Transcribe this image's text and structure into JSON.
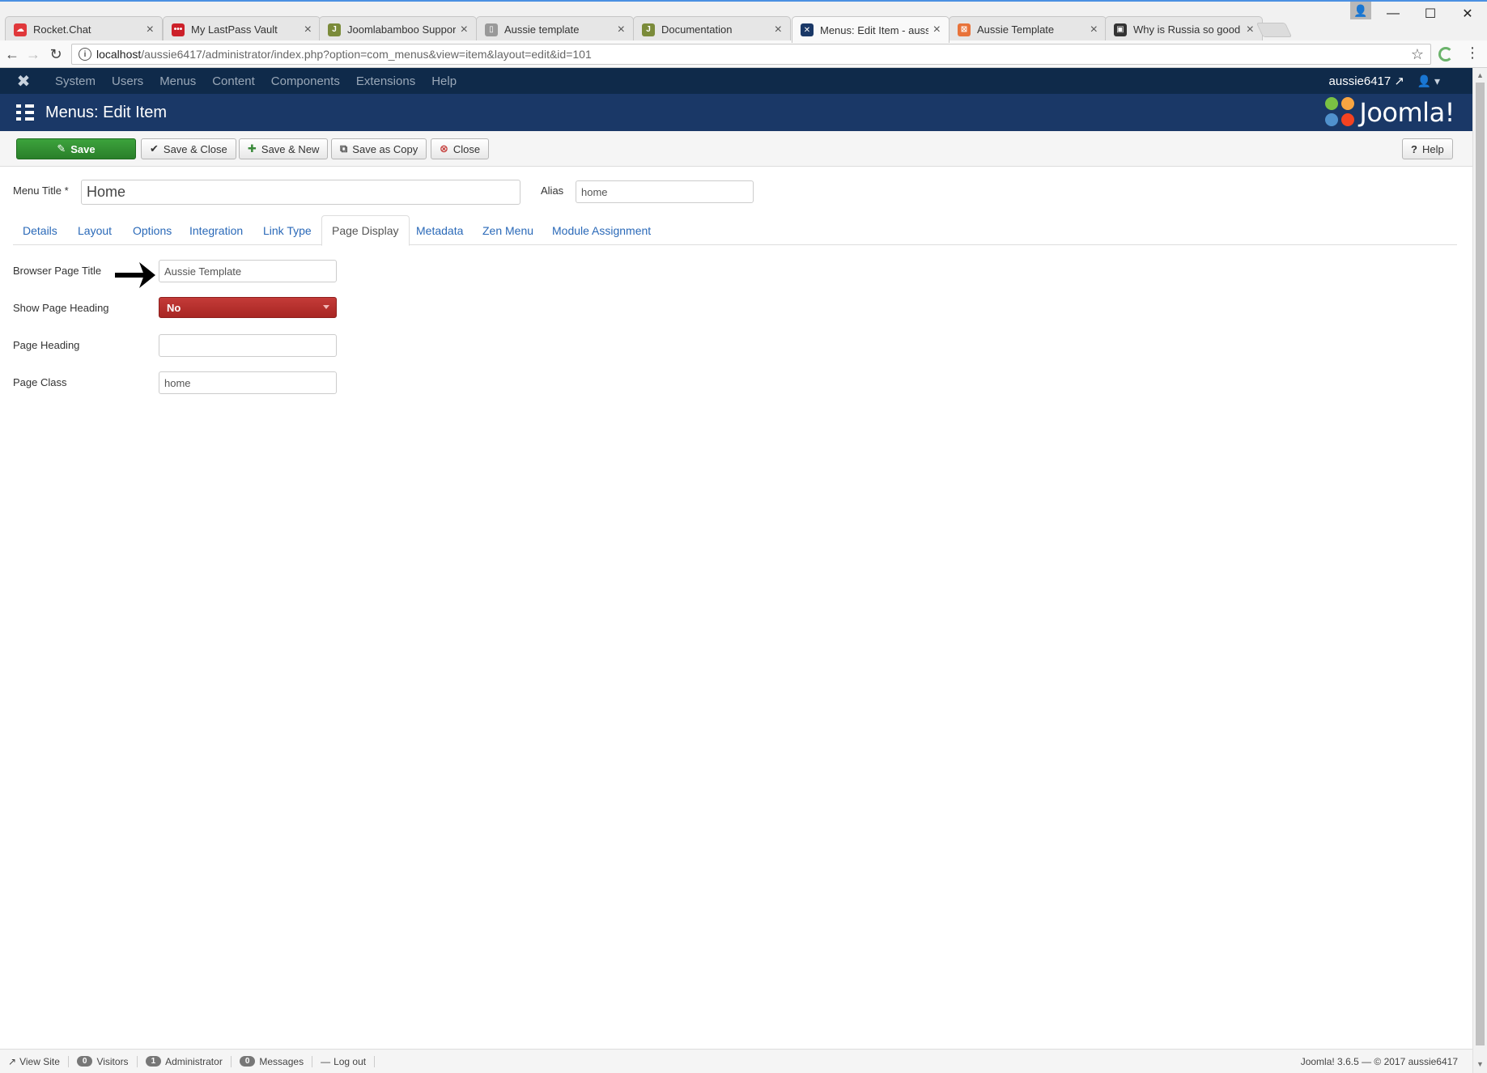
{
  "browser": {
    "tabs": [
      {
        "label": "Rocket.Chat",
        "fav_color": "#e0383b",
        "fav_glyph": "☁"
      },
      {
        "label": "My LastPass Vault",
        "fav_color": "#cc2029",
        "fav_glyph": "•••"
      },
      {
        "label": "Joomlabamboo Support",
        "fav_color": "#7b8b3a",
        "fav_glyph": "J"
      },
      {
        "label": "Aussie template",
        "fav_color": "#999999",
        "fav_glyph": "▯"
      },
      {
        "label": "Documentation",
        "fav_color": "#7b8b3a",
        "fav_glyph": "J"
      },
      {
        "label": "Menus: Edit Item - aussie",
        "fav_color": "#1a3867",
        "fav_glyph": "✕"
      },
      {
        "label": "Aussie Template",
        "fav_color": "#e8733a",
        "fav_glyph": "⊠"
      },
      {
        "label": "Why is Russia so good at",
        "fav_color": "#333333",
        "fav_glyph": "▣"
      }
    ],
    "url_host": "localhost",
    "url_path": "/aussie6417/administrator/index.php?option=com_menus&view=item&layout=edit&id=101"
  },
  "topnav": {
    "items": [
      "System",
      "Users",
      "Menus",
      "Content",
      "Components",
      "Extensions",
      "Help"
    ],
    "user": "aussie6417"
  },
  "header": {
    "title": "Menus: Edit Item",
    "brand": "Joomla!"
  },
  "toolbar": {
    "save": "Save",
    "save_close": "Save & Close",
    "save_new": "Save & New",
    "save_copy": "Save as Copy",
    "close": "Close",
    "help": "Help"
  },
  "form": {
    "menu_title_label": "Menu Title *",
    "menu_title_value": "Home",
    "alias_label": "Alias",
    "alias_value": "home",
    "tabs": [
      "Details",
      "Layout",
      "Options",
      "Integration",
      "Link Type",
      "Page Display",
      "Metadata",
      "Zen Menu",
      "Module Assignment"
    ],
    "active_tab": "Page Display",
    "browser_page_title_label": "Browser Page Title",
    "browser_page_title_value": "Aussie Template",
    "show_page_heading_label": "Show Page Heading",
    "show_page_heading_value": "No",
    "page_heading_label": "Page Heading",
    "page_heading_value": "",
    "page_class_label": "Page Class",
    "page_class_value": "home"
  },
  "status": {
    "view_site": "View Site",
    "visitors_count": "0",
    "visitors_label": "Visitors",
    "admin_count": "1",
    "admin_label": "Administrator",
    "messages_count": "0",
    "messages_label": "Messages",
    "logout": "Log out",
    "version": "Joomla! 3.6.5 — © 2017 aussie6417"
  },
  "colors": {
    "topnav_bg": "#0f2a4a",
    "header_bg": "#1a3867",
    "save_green": "#2a7f2a",
    "select_red": "#a82623",
    "link_blue": "#2a69b8"
  }
}
